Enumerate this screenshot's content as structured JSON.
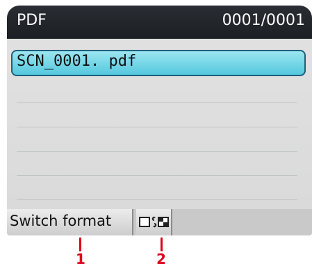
{
  "header": {
    "title": "PDF",
    "counter": "0001/0001"
  },
  "file_list": {
    "items": [
      {
        "label": "SCN_0001. pdf",
        "selected": true
      }
    ]
  },
  "bottom_bar": {
    "switch_format_label": "Switch format",
    "view_toggle_icon": "single-page-and-thumbnail-toggle-icon"
  },
  "callouts": {
    "one": "1",
    "two": "2"
  },
  "colors": {
    "titlebar": "#1f2227",
    "selection": "#6cd2e3",
    "callout": "#e0001b"
  }
}
